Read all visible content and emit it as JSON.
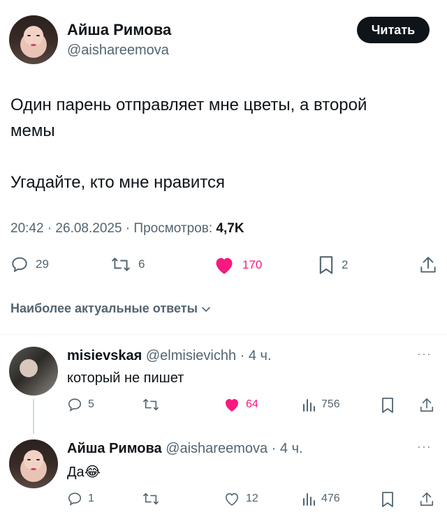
{
  "tweet": {
    "author_name": "Айша Римова",
    "author_handle": "@aishareemova",
    "follow_label": "Читать",
    "text": "Один парень отправляет мне цветы, а второй\nмемы\n\nУгадайте, кто мне нравится",
    "time_date": "20:42 · 26.08.2025 · Просмотров: ",
    "views": "4,7K",
    "actions": {
      "replies": "29",
      "retweets": "6",
      "likes": "170",
      "bookmarks": "2"
    }
  },
  "replies_sort_label": "Наиболее актуальные ответы",
  "replies": [
    {
      "author_name": "misievskaя",
      "author_handle": "@elmisievichh · 4 ч.",
      "text": "который не пишет",
      "replies": "5",
      "likes": "64",
      "views": "756"
    },
    {
      "author_name": "Айша Римова",
      "author_handle": "@aishareemova · 4 ч.",
      "text": "Да",
      "emoji": "😂",
      "replies": "1",
      "likes": "12",
      "views": "476"
    }
  ],
  "colors": {
    "like_active": "#f91880",
    "muted": "#536471",
    "text": "#0f1419",
    "follow_bg": "#0f1419"
  },
  "icons": [
    "reply-icon",
    "retweet-icon",
    "heart-icon",
    "bookmark-icon",
    "share-icon",
    "views-icon",
    "more-icon",
    "chevron-down-icon"
  ]
}
